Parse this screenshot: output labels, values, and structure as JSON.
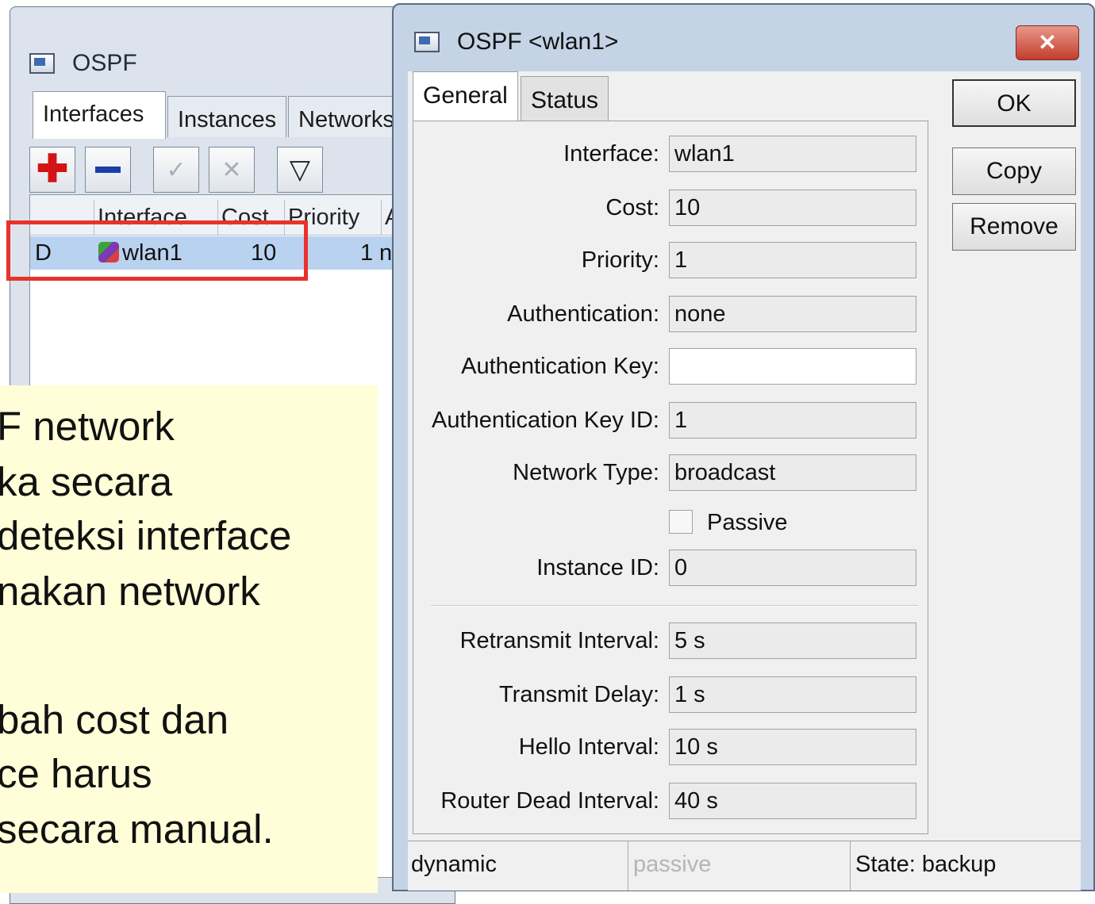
{
  "back_window": {
    "title": "OSPF",
    "tabs": [
      "Interfaces",
      "Instances",
      "Networks"
    ],
    "toolbar": {
      "add_icon": "plus-icon",
      "remove_icon": "minus-icon",
      "enable_icon": "check-icon",
      "disable_icon": "x-icon",
      "filter_icon": "filter-icon"
    },
    "list": {
      "columns": [
        "",
        "Interface",
        "Cost",
        "Priority",
        "A"
      ],
      "rows": [
        {
          "flag": "D",
          "interface": "wlan1",
          "cost": "10",
          "priority": "1",
          "extra": "n"
        }
      ]
    }
  },
  "note": {
    "lines": [
      "F network",
      "ka secara",
      "deteksi interface",
      "nakan network",
      "",
      "bah cost dan",
      "ce harus",
      "secara manual."
    ]
  },
  "dialog": {
    "title": "OSPF <wlan1>",
    "close_label": "✕",
    "tabs": {
      "general": "General",
      "status": "Status"
    },
    "buttons": {
      "ok": "OK",
      "copy": "Copy",
      "remove": "Remove"
    },
    "fields": {
      "interface": {
        "label": "Interface:",
        "value": "wlan1"
      },
      "cost": {
        "label": "Cost:",
        "value": "10"
      },
      "priority": {
        "label": "Priority:",
        "value": "1"
      },
      "authentication": {
        "label": "Authentication:",
        "value": "none"
      },
      "auth_key": {
        "label": "Authentication Key:",
        "value": ""
      },
      "auth_key_id": {
        "label": "Authentication Key ID:",
        "value": "1"
      },
      "network_type": {
        "label": "Network Type:",
        "value": "broadcast"
      },
      "instance_id": {
        "label": "Instance ID:",
        "value": "0"
      },
      "retransmit_interval": {
        "label": "Retransmit Interval:",
        "value": "5 s"
      },
      "transmit_delay": {
        "label": "Transmit Delay:",
        "value": "1 s"
      },
      "hello_interval": {
        "label": "Hello Interval:",
        "value": "10 s"
      },
      "router_dead_interval": {
        "label": "Router Dead Interval:",
        "value": "40 s"
      }
    },
    "passive": {
      "label": "Passive",
      "checked": false
    },
    "status_bar": {
      "left": "dynamic",
      "middle": "passive",
      "right": "State: backup"
    }
  },
  "colors": {
    "highlight": "#e8322a",
    "note_bg": "#fffed8",
    "selected_row": "#b9d2ef"
  }
}
